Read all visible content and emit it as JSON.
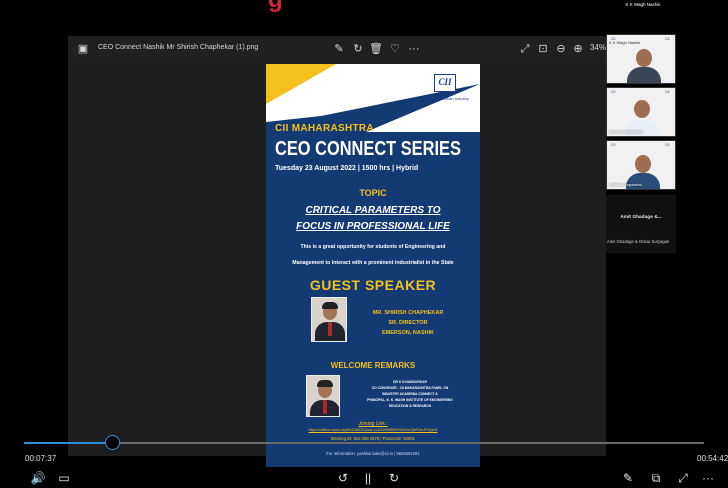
{
  "window": {
    "file_title": "CEO Connect Nashik Mr Shirish Chaphekar (1).png",
    "zoom": "34%"
  },
  "poster": {
    "logo": "CII",
    "logo_name": "Confederation of Indian Industry",
    "org": "CII MAHARASHTRA",
    "series": "CEO CONNECT SERIES",
    "datetime": "Tuesday 23 August 2022 | 1500 hrs | Hybrid",
    "topic_label": "TOPIC",
    "topic_line1": "CRITICAL PARAMETERS TO",
    "topic_line2": "FOCUS IN PROFESSIONAL LIFE",
    "desc_line1": "This is a great opportunity for students of Engineering and",
    "desc_line2": "Management to interact with a prominent industrialist in the State",
    "guest_label": "GUEST SPEAKER",
    "speaker_name": "MR. SHIRISH CHAPHEKAR",
    "speaker_title": "SR. DIRECTOR",
    "speaker_company": "EMERSON, NASHIK",
    "welcome_label": "WELCOME REMARKS",
    "welcome_lines": [
      "DR K N NANDURKAR",
      "CO CONVENOR - CII MAHARASHTRA PANEL ON",
      "INDUSTRY ACADEMIA CONNECT &",
      "PRINCIPAL, K. K. WAGH INSTITUTE OF ENGINEERING",
      "EDUCATION & RESEARCH",
      ""
    ],
    "join_label": "Joining Link :",
    "join_url": "https://cii8live.zoom.us/j/81508608?pwd=cUd7eWN5ReRG87aZQbR1eUF9Qz09",
    "meeting_id": "Meeting ID: 815 086 0879 | Passcode: 94001",
    "info_line": "For Information: yashkar.kale@cii.in | 9826551081"
  },
  "participants": {
    "top_label": "K K Wagh Nashik",
    "tile1_name": "K K Wagh Nashik",
    "tile2_name": "Keshav Nandurkar",
    "tile3_name": "Shirish Chaphekar",
    "amit_name": "Amit Ghadage &...",
    "amit_sub": "Amit Ghadage & Onkar Suryagan",
    "tile_brand": "CII"
  },
  "player": {
    "elapsed": "00:07:37",
    "remaining": "00:54:42",
    "progress": 0.13
  },
  "colors": {
    "accent": "#2f8fd8",
    "poster_blue": "#143a73",
    "poster_yellow": "#f3c01c"
  }
}
